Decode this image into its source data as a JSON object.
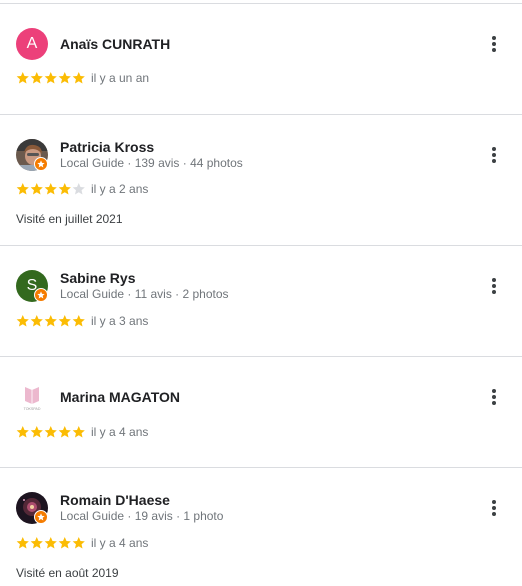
{
  "reviews": [
    {
      "name": "Anaïs CUNRATH",
      "avatar_letter": "A",
      "avatar_color": "#ec407a",
      "rating": 5,
      "time": "il y a un an"
    },
    {
      "name": "Patricia Kross",
      "meta": "Local Guide · 139 avis · 44 photos",
      "rating": 4,
      "time": "il y a 2 ans",
      "visit": "Visité en juillet 2021"
    },
    {
      "name": "Sabine Rys",
      "avatar_letter": "S",
      "avatar_color": "#33691e",
      "meta": "Local Guide · 11 avis · 2 photos",
      "rating": 5,
      "time": "il y a 3 ans"
    },
    {
      "name": "Marina MAGATON",
      "avatar_logo_text": "TOKSPAD",
      "rating": 5,
      "time": "il y a 4 ans"
    },
    {
      "name": "Romain D'Haese",
      "meta": "Local Guide · 19 avis · 1 photo",
      "rating": 5,
      "time": "il y a 4 ans",
      "visit": "Visité en août 2019"
    }
  ],
  "colors": {
    "star_filled": "#fbbc04",
    "star_empty": "#dadce0",
    "local_guide_badge": "#f57c00"
  }
}
